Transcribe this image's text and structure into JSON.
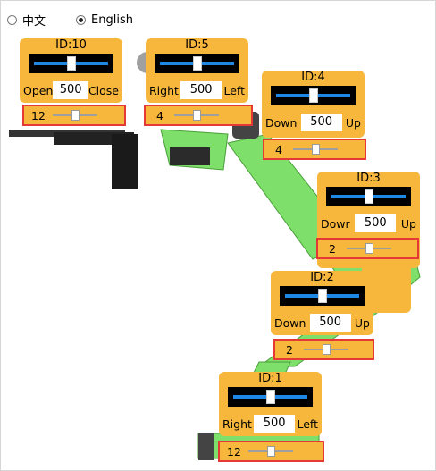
{
  "language": {
    "options": [
      {
        "label": "中文",
        "selected": false
      },
      {
        "label": "English",
        "selected": true
      }
    ]
  },
  "panels": {
    "id10": {
      "id_label": "ID:10",
      "left_label": "Open",
      "value": "500",
      "right_label": "Close",
      "speed": "12"
    },
    "id5": {
      "id_label": "ID:5",
      "left_label": "Right",
      "value": "500",
      "right_label": "Left",
      "speed": "4"
    },
    "id4": {
      "id_label": "ID:4",
      "left_label": "Down",
      "value": "500",
      "right_label": "Up",
      "speed": "4"
    },
    "id3": {
      "id_label": "ID:3",
      "left_label": "Dowr",
      "value": "500",
      "right_label": "Up",
      "speed": "2"
    },
    "id2": {
      "id_label": "ID:2",
      "left_label": "Down",
      "value": "500",
      "right_label": "Up",
      "speed": "2"
    },
    "id1": {
      "id_label": "ID:1",
      "left_label": "Right",
      "value": "500",
      "right_label": "Left",
      "speed": "12"
    }
  },
  "colors": {
    "panel": "#f6b73c",
    "highlight": "#e53935",
    "slider_track": "#1e88e5",
    "arm": "#7ee06a"
  }
}
